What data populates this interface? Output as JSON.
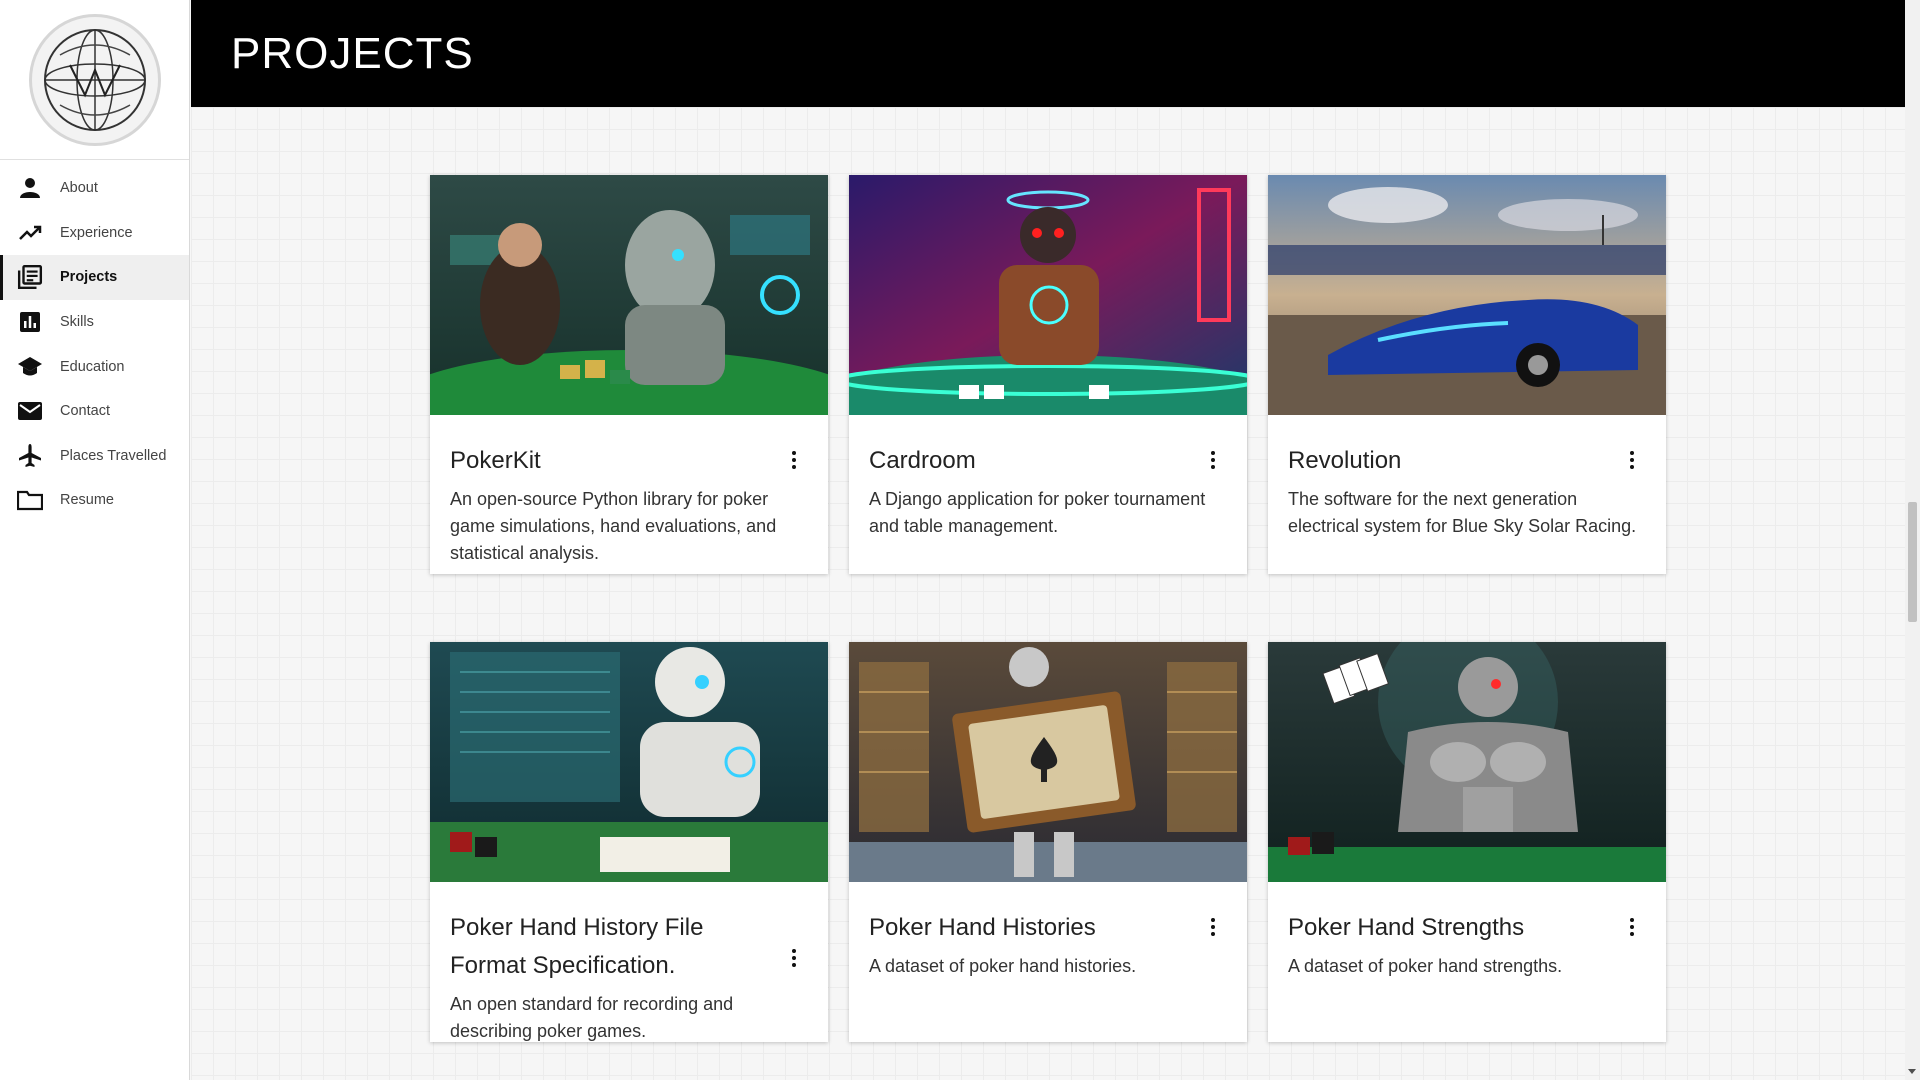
{
  "header": {
    "title": "PROJECTS"
  },
  "sidebar": {
    "logo_icon": "world-globe-logo",
    "items": [
      {
        "label": "About",
        "icon": "person-icon",
        "active": false
      },
      {
        "label": "Experience",
        "icon": "trending-up-icon",
        "active": false
      },
      {
        "label": "Projects",
        "icon": "library-books-icon",
        "active": true
      },
      {
        "label": "Skills",
        "icon": "bar-chart-icon",
        "active": false
      },
      {
        "label": "Education",
        "icon": "school-icon",
        "active": false
      },
      {
        "label": "Contact",
        "icon": "mail-icon",
        "active": false
      },
      {
        "label": "Places Travelled",
        "icon": "airplane-icon",
        "active": false
      },
      {
        "label": "Resume",
        "icon": "folder-icon",
        "active": false
      }
    ]
  },
  "projects": [
    {
      "title": "PokerKit",
      "description": "An open-source Python library for poker game simulations, hand evaluations, and statistical analysis.",
      "image": "robot-poker-player-image"
    },
    {
      "title": "Cardroom",
      "description": "A Django application for poker tournament and table management.",
      "image": "neon-robot-poker-room-image"
    },
    {
      "title": "Revolution",
      "description": "The software for the next generation electrical system for Blue Sky Solar Racing.",
      "image": "solar-race-car-image"
    },
    {
      "title": "Poker Hand History File Format Specification.",
      "description": "An open standard for recording and describing poker games.",
      "image": "robot-writing-hand-histories-image"
    },
    {
      "title": "Poker Hand Histories",
      "description": "A dataset of poker hand histories.",
      "image": "robot-carrying-book-image"
    },
    {
      "title": "Poker Hand Strengths",
      "description": "A dataset of poker hand strengths.",
      "image": "muscular-robot-cards-image"
    }
  ],
  "colors": {
    "header_bg": "#000000",
    "accent": "#111111",
    "page_bg": "#f6f6f6"
  }
}
